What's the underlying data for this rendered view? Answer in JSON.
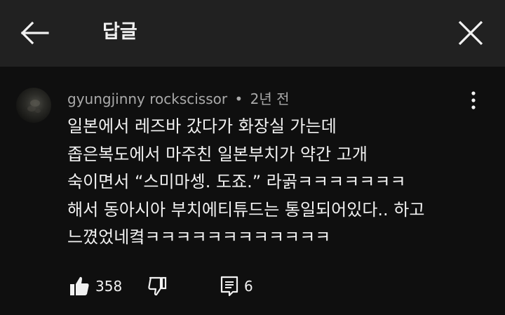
{
  "header": {
    "title": "답글"
  },
  "comment": {
    "author": "gyungjinny rockscissor",
    "separator": "•",
    "time_ago": "2년 전",
    "lines": [
      "일본에서 레즈바 갔다가 화장실 가는데",
      "좁은복도에서 마주친 일본부치가 약간 고개",
      "숙이면서 “스미마셍. 도죠.” 라곩ㅋㅋㅋㅋㅋㅋㅋ",
      "해서 동아시아 부치에티튜드는 통일되어있다.. 하고",
      "느꼈었네켴ㅋㅋㅋㅋㅋㅋㅋㅋㅋㅋㅋㅋ"
    ],
    "like_count": "358",
    "reply_count": "6"
  },
  "icons": {
    "back": "arrow-left-icon",
    "close": "close-icon",
    "more": "more-vert-icon",
    "like": "thumb-up-icon",
    "dislike": "thumb-down-icon",
    "reply": "comment-icon"
  },
  "colors": {
    "background": "#0f0f0f",
    "header_background": "#212121",
    "text_primary": "#f1f1f1",
    "text_secondary": "#aaaaaa"
  }
}
